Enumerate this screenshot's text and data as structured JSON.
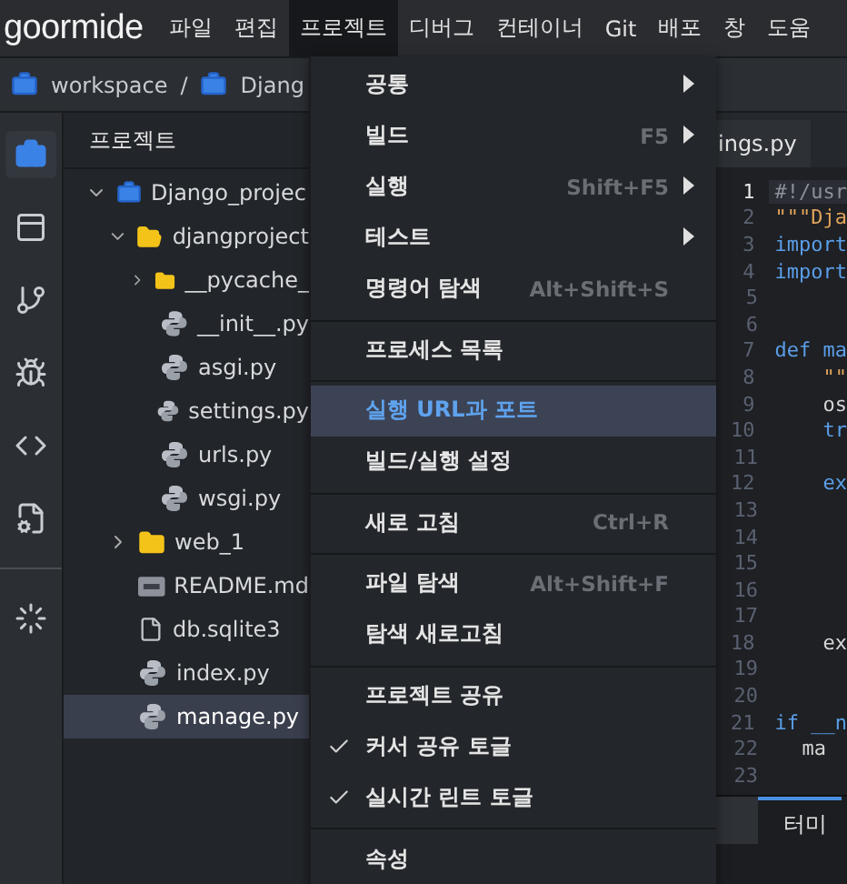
{
  "menubar": {
    "logo": "goormide",
    "items": [
      {
        "label": "파일",
        "selected": false
      },
      {
        "label": "편집",
        "selected": false
      },
      {
        "label": "프로젝트",
        "selected": true
      },
      {
        "label": "디버그",
        "selected": false
      },
      {
        "label": "컨테이너",
        "selected": false
      },
      {
        "label": "Git",
        "selected": false
      },
      {
        "label": "배포",
        "selected": false
      },
      {
        "label": "창",
        "selected": false
      },
      {
        "label": "도움",
        "selected": false
      }
    ]
  },
  "breadcrumb": {
    "separator": "/",
    "items": [
      "workspace",
      "Djang"
    ]
  },
  "activity_bar": [
    {
      "kind": "briefcase",
      "selected": true
    },
    {
      "kind": "panel",
      "selected": false
    },
    {
      "kind": "branch",
      "selected": false
    },
    {
      "kind": "bug",
      "selected": false
    },
    {
      "kind": "code",
      "selected": false
    },
    {
      "kind": "container",
      "selected": false
    },
    {
      "kind": "spinner",
      "selected": false
    }
  ],
  "explorer": {
    "title": "프로젝트",
    "tree": [
      {
        "name": "Django_projec",
        "kind": "project",
        "expanded": true,
        "selected": false,
        "children": [
          {
            "name": "djangproject",
            "kind": "folder",
            "expanded": true,
            "selected": false,
            "children": [
              {
                "name": "__pycache_",
                "kind": "folder",
                "expanded": false,
                "selected": false
              },
              {
                "name": "__init__.py",
                "kind": "python",
                "selected": false
              },
              {
                "name": "asgi.py",
                "kind": "python",
                "selected": false
              },
              {
                "name": "settings.py",
                "kind": "python",
                "selected": false
              },
              {
                "name": "urls.py",
                "kind": "python",
                "selected": false
              },
              {
                "name": "wsgi.py",
                "kind": "python",
                "selected": false
              }
            ]
          },
          {
            "name": "web_1",
            "kind": "folder",
            "expanded": false,
            "selected": false
          },
          {
            "name": "README.md",
            "kind": "markdown",
            "selected": false
          },
          {
            "name": "db.sqlite3",
            "kind": "file",
            "selected": false
          },
          {
            "name": "index.py",
            "kind": "python",
            "selected": false
          },
          {
            "name": "manage.py",
            "kind": "python",
            "selected": true
          }
        ]
      }
    ]
  },
  "menu": {
    "items": [
      {
        "kind": "item",
        "label": "공통",
        "submenu": true,
        "checked": false,
        "selected": false
      },
      {
        "kind": "item",
        "label": "빌드",
        "shortcut": "F5",
        "submenu": true,
        "checked": false,
        "selected": false
      },
      {
        "kind": "item",
        "label": "실행",
        "shortcut": "Shift+F5",
        "submenu": true,
        "checked": false,
        "selected": false
      },
      {
        "kind": "item",
        "label": "테스트",
        "submenu": true,
        "checked": false,
        "selected": false
      },
      {
        "kind": "item",
        "label": "명령어 탐색",
        "shortcut": "Alt+Shift+S",
        "submenu": false,
        "checked": false,
        "selected": false
      },
      {
        "kind": "separator"
      },
      {
        "kind": "item",
        "label": "프로세스 목록",
        "submenu": false,
        "checked": false,
        "selected": false
      },
      {
        "kind": "separator"
      },
      {
        "kind": "item",
        "label": "실행 URL과 포트",
        "submenu": false,
        "checked": false,
        "selected": true
      },
      {
        "kind": "item",
        "label": "빌드/실행 설정",
        "submenu": false,
        "checked": false,
        "selected": false
      },
      {
        "kind": "separator"
      },
      {
        "kind": "item",
        "label": "새로 고침",
        "shortcut": "Ctrl+R",
        "submenu": false,
        "checked": false,
        "selected": false
      },
      {
        "kind": "separator"
      },
      {
        "kind": "item",
        "label": "파일 탐색",
        "shortcut": "Alt+Shift+F",
        "submenu": false,
        "checked": false,
        "selected": false
      },
      {
        "kind": "item",
        "label": "탐색 새로고침",
        "submenu": false,
        "checked": false,
        "selected": false
      },
      {
        "kind": "separator"
      },
      {
        "kind": "item",
        "label": "프로젝트 공유",
        "submenu": false,
        "checked": false,
        "selected": false
      },
      {
        "kind": "item",
        "label": "커서 공유 토글",
        "submenu": false,
        "checked": true,
        "selected": false
      },
      {
        "kind": "item",
        "label": "실시간 린트 토글",
        "submenu": false,
        "checked": true,
        "selected": false
      },
      {
        "kind": "separator"
      },
      {
        "kind": "item",
        "label": "속성",
        "submenu": false,
        "checked": false,
        "selected": false
      }
    ]
  },
  "editor": {
    "tab": "ings.py",
    "lines": [
      {
        "number": "1",
        "code": "#!/usr",
        "kind": "comment",
        "current": true
      },
      {
        "number": "2",
        "code": "\"\"\"Dja",
        "kind": "string",
        "current": false
      },
      {
        "number": "3",
        "code": "import",
        "kind": "keyword",
        "current": false
      },
      {
        "number": "4",
        "code": "import",
        "kind": "keyword",
        "current": false
      },
      {
        "number": "5",
        "current": false
      },
      {
        "number": "6",
        "current": false
      },
      {
        "number": "7",
        "code": "def ma",
        "kind": "keyword",
        "current": false
      },
      {
        "number": "8",
        "code": "    \"\"",
        "kind": "string",
        "current": false
      },
      {
        "number": "9",
        "code": "    os",
        "kind": "plain",
        "current": false
      },
      {
        "number": "10",
        "code": "    tr",
        "kind": "keyword",
        "current": false
      },
      {
        "number": "11",
        "current": false
      },
      {
        "number": "12",
        "code": "    ex",
        "kind": "keyword",
        "current": false
      },
      {
        "number": "13",
        "current": false
      },
      {
        "number": "14",
        "current": false
      },
      {
        "number": "15",
        "current": false
      },
      {
        "number": "16",
        "current": false
      },
      {
        "number": "17",
        "current": false
      },
      {
        "number": "18",
        "code": "    ex",
        "kind": "plain",
        "current": false
      },
      {
        "number": "19",
        "current": false
      },
      {
        "number": "20",
        "current": false
      },
      {
        "number": "21",
        "code": "if __n",
        "kind": "keyword",
        "current": false
      },
      {
        "number": "22",
        "code": "  ma",
        "kind": "plain",
        "current": false
      },
      {
        "number": "23",
        "current": false
      }
    ]
  },
  "bottom_tabs": [
    {
      "label": "터미",
      "selected": true
    }
  ]
}
